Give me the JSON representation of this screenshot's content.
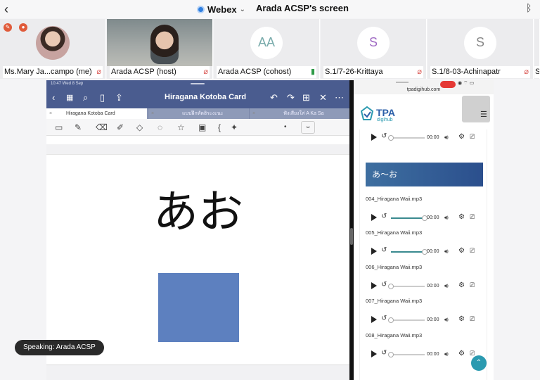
{
  "topbar": {
    "back_icon": "chevron-left-icon",
    "app_name": "Webex",
    "screen_title": "Arada ACSP's screen",
    "bluetooth_icon": "bluetooth-icon"
  },
  "participants": [
    {
      "name": "Ms.Mary Ja...campo (me)",
      "avatar": "photo",
      "mic": "muted"
    },
    {
      "name": "Arada ACSP (host)",
      "avatar": "video",
      "mic": "muted"
    },
    {
      "name": "Arada ACSP (cohost)",
      "avatar_initials": "AA",
      "mic": "on"
    },
    {
      "name": "S.1/7-26-Krittaya",
      "avatar_initials": "S",
      "mic": "muted"
    },
    {
      "name": "S.1/8-03-Achinapatr",
      "avatar_initials": "S",
      "mic": "muted"
    },
    {
      "name": "S",
      "avatar_initials": "",
      "mic": ""
    }
  ],
  "goodnotes": {
    "status_time": "10:47  Wed 8 Sep",
    "title": "Hiragana Kotoba Card",
    "tabs": [
      "Hiragana Kotoba Card",
      "แบบฝึกหัดฮิระงะนะ",
      "ฟังเสียงใส่ A Ka Sa"
    ],
    "kana_text": "あお",
    "card_color": "#5d80bf"
  },
  "browser": {
    "url": "tpadigihub.com",
    "logo_text": "TPA",
    "logo_sub": "digihub",
    "section_title": "あ〜お",
    "players": [
      {
        "label": "",
        "time": "00:00",
        "progress": 0.0
      },
      {
        "label": "004_Hiragana Waii.mp3",
        "time": "00:00",
        "progress": 1.0
      },
      {
        "label": "005_Hiragana Waii.mp3",
        "time": "00:00",
        "progress": 1.0
      },
      {
        "label": "006_Hiragana Waii.mp3",
        "time": "00:00",
        "progress": 0.0
      },
      {
        "label": "007_Hiragana Waii.mp3",
        "time": "00:00",
        "progress": 0.0
      },
      {
        "label": "008_Hiragana Waii.mp3",
        "time": "00:00",
        "progress": 0.0
      }
    ]
  },
  "speaking": "Speaking: Arada ACSP",
  "colors": {
    "accent": "#2f7fe0",
    "toolbar": "#4a5c8f",
    "banner": "#2b4f8d",
    "mute": "#d9534f",
    "mic_on": "#2e9a47"
  }
}
